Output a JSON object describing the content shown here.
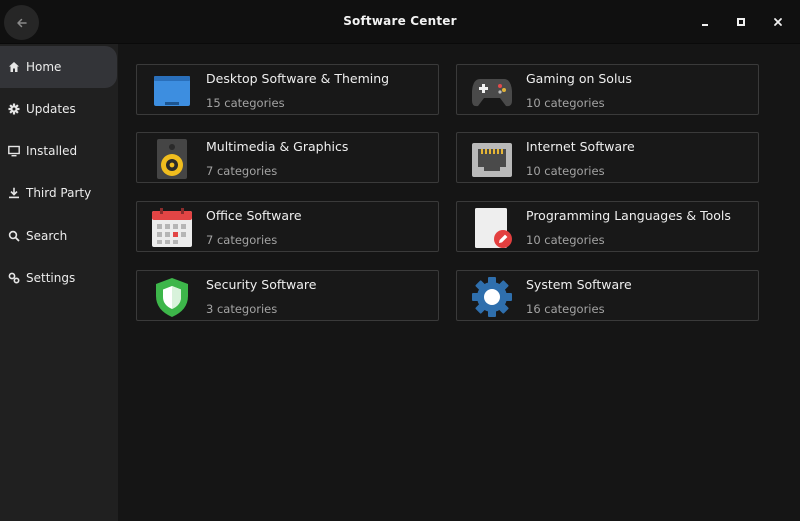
{
  "window": {
    "title": "Software Center",
    "controls": [
      "minimize-icon",
      "maximize-icon",
      "close-icon"
    ]
  },
  "sidebar": {
    "items": [
      {
        "label": "Home",
        "icon": "home-icon",
        "active": true
      },
      {
        "label": "Updates",
        "icon": "gear-icon",
        "active": false
      },
      {
        "label": "Installed",
        "icon": "monitor-icon",
        "active": false
      },
      {
        "label": "Third Party",
        "icon": "download-icon",
        "active": false
      },
      {
        "label": "Search",
        "icon": "search-icon",
        "active": false
      },
      {
        "label": "Settings",
        "icon": "settings-icon",
        "active": false
      }
    ]
  },
  "categories": [
    {
      "title": "Desktop Software & Theming",
      "subtitle": "15 categories",
      "icon": "desktop-icon"
    },
    {
      "title": "Gaming on Solus",
      "subtitle": "10 categories",
      "icon": "gamepad-icon"
    },
    {
      "title": "Multimedia & Graphics",
      "subtitle": "7 categories",
      "icon": "speaker-icon"
    },
    {
      "title": "Internet Software",
      "subtitle": "10 categories",
      "icon": "network-port-icon"
    },
    {
      "title": "Office Software",
      "subtitle": "7 categories",
      "icon": "calendar-icon"
    },
    {
      "title": "Programming Languages & Tools",
      "subtitle": "10 categories",
      "icon": "text-editor-icon"
    },
    {
      "title": "Security Software",
      "subtitle": "3 categories",
      "icon": "shield-icon"
    },
    {
      "title": "System Software",
      "subtitle": "16 categories",
      "icon": "cog-icon"
    }
  ],
  "colors": {
    "background": "#151515",
    "sidebar": "#202020",
    "active_item": "#333438",
    "card_border": "#3a3a3a",
    "subtitle_text": "#a3a3a3"
  }
}
